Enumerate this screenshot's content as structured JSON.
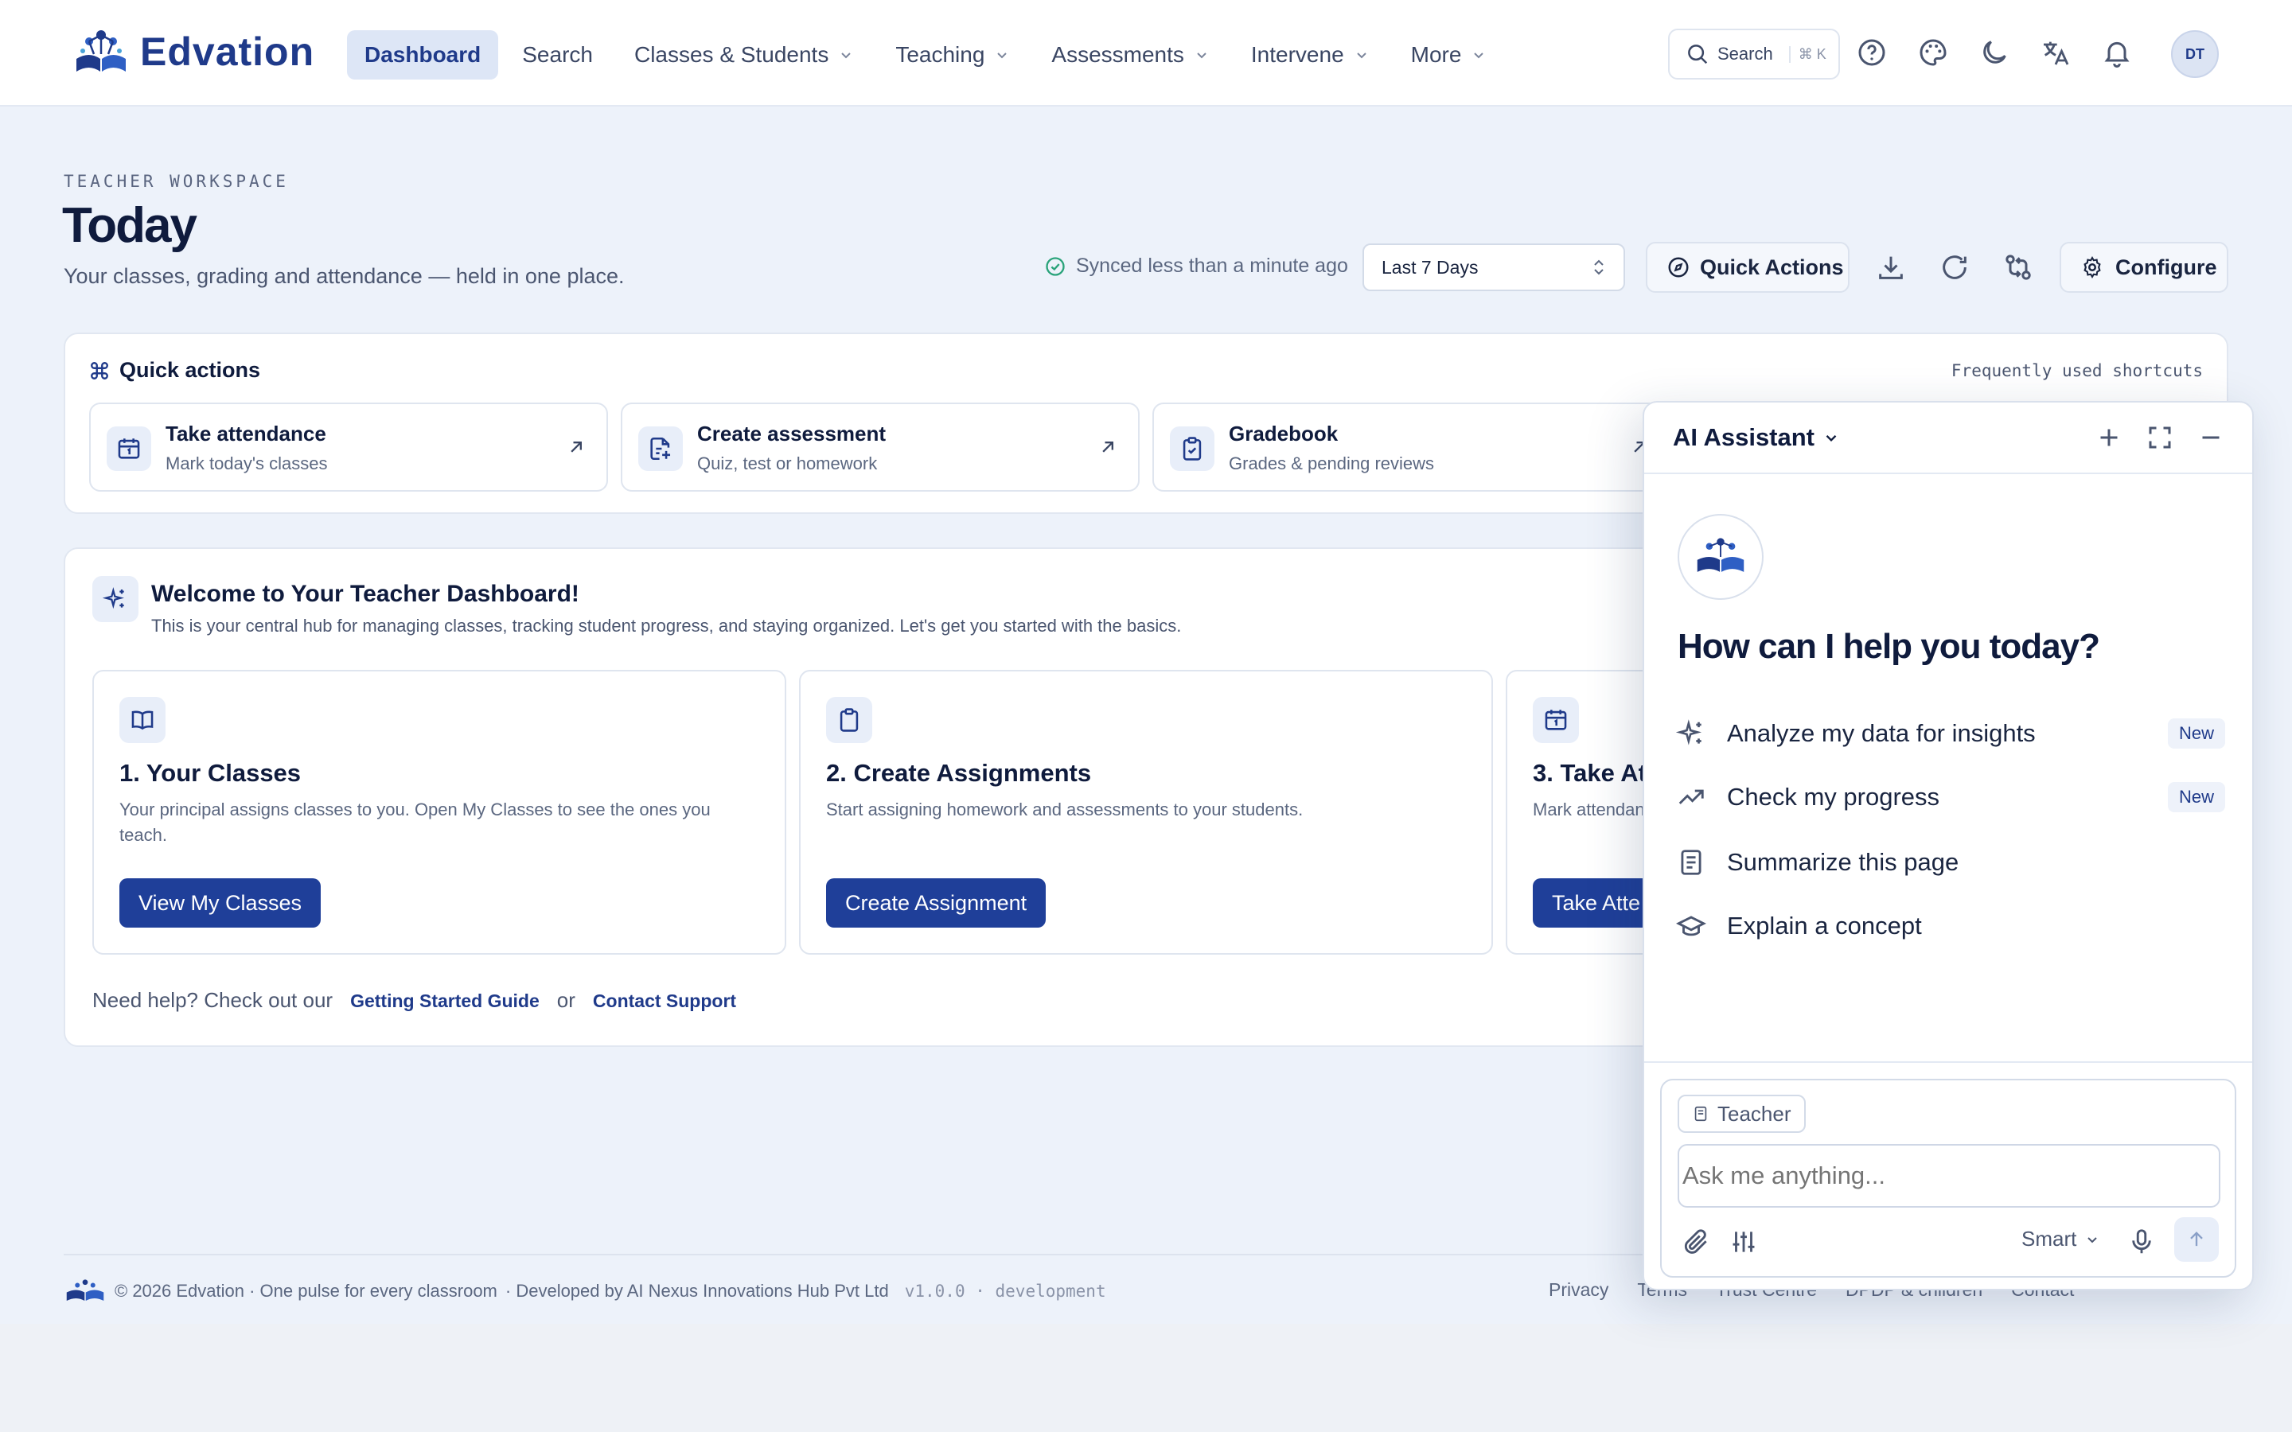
{
  "app": {
    "name": "Edvation"
  },
  "nav": {
    "items": [
      {
        "label": "Dashboard",
        "active": true,
        "has_dropdown": false
      },
      {
        "label": "Search",
        "active": false,
        "has_dropdown": false
      },
      {
        "label": "Classes & Students",
        "active": false,
        "has_dropdown": true
      },
      {
        "label": "Teaching",
        "active": false,
        "has_dropdown": true
      },
      {
        "label": "Assessments",
        "active": false,
        "has_dropdown": true
      },
      {
        "label": "Intervene",
        "active": false,
        "has_dropdown": true
      },
      {
        "label": "More",
        "active": false,
        "has_dropdown": true
      }
    ],
    "search_label": "Search",
    "search_shortcut": "⌘ K",
    "icons": [
      "help-icon",
      "palette-icon",
      "moon-icon",
      "translate-icon",
      "bell-icon"
    ],
    "avatar_initials": "DT"
  },
  "header": {
    "eyebrow": "TEACHER WORKSPACE",
    "title": "Today",
    "subtitle": "Your classes, grading and attendance — held in one place.",
    "sync_status": "Synced less than a minute ago",
    "date_range": "Last 7 Days",
    "quick_actions_label": "Quick Actions",
    "configure_label": "Configure"
  },
  "quick_actions": {
    "title": "Quick actions",
    "hint": "Frequently used shortcuts",
    "tiles": [
      {
        "title": "Take attendance",
        "subtitle": "Mark today's classes",
        "icon": "calendar-icon"
      },
      {
        "title": "Create assessment",
        "subtitle": "Quiz, test or homework",
        "icon": "file-plus-icon"
      },
      {
        "title": "Gradebook",
        "subtitle": "Grades & pending reviews",
        "icon": "clipboard-check-icon"
      }
    ]
  },
  "welcome": {
    "title": "Welcome to Your Teacher Dashboard!",
    "subtitle": "This is your central hub for managing classes, tracking student progress, and staying organized. Let's get you started with the basics.",
    "steps": [
      {
        "title": "1. Your Classes",
        "desc": "Your principal assigns classes to you. Open My Classes to see the ones you teach.",
        "button": "View My Classes",
        "icon": "book-open-icon"
      },
      {
        "title": "2. Create Assignments",
        "desc": "Start assigning homework and assessments to your students.",
        "button": "Create Assignment",
        "icon": "clipboard-icon"
      },
      {
        "title": "3. Take At",
        "desc": "Mark attendan",
        "button": "Take Atte",
        "icon": "calendar-icon"
      }
    ],
    "help_prefix": "Need help? Check out our",
    "help_link_1": "Getting Started Guide",
    "help_or": "or",
    "help_link_2": "Contact Support"
  },
  "footer": {
    "copyright": "© 2026 Edvation · One pulse for every classroom",
    "developer": "· Developed by AI Nexus Innovations Hub Pvt Ltd",
    "version": "v1.0.0 · development",
    "links": [
      "Privacy",
      "Terms",
      "Trust Centre",
      "DPDP & children",
      "Contact"
    ]
  },
  "ai_assistant": {
    "title": "AI Assistant",
    "question": "How can I help you today?",
    "suggestions": [
      {
        "label": "Analyze my data for insights",
        "badge": "New",
        "icon": "sparkles-icon"
      },
      {
        "label": "Check my progress",
        "badge": "New",
        "icon": "trending-up-icon"
      },
      {
        "label": "Summarize this page",
        "badge": "",
        "icon": "document-icon"
      },
      {
        "label": "Explain a concept",
        "badge": "",
        "icon": "graduation-cap-icon"
      }
    ],
    "context_chip": "Teacher",
    "input_placeholder": "Ask me anything...",
    "model": "Smart"
  }
}
